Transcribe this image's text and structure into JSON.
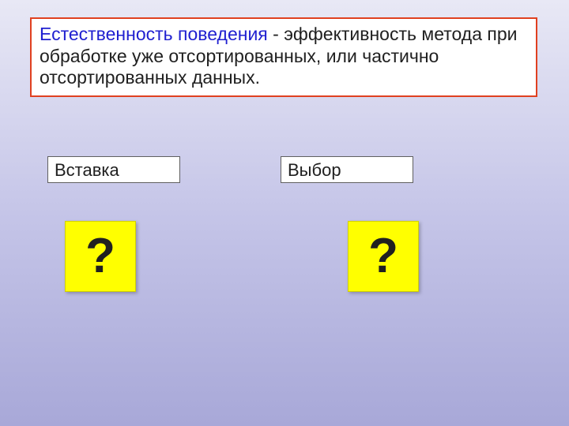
{
  "definition": {
    "term": "Естественность поведения",
    "desc": " - эффективность метода при обработке уже отсортированных, или частично отсортированных данных."
  },
  "labels": {
    "left": "Вставка",
    "right": "Выбор"
  },
  "questions": {
    "left": "?",
    "right": "?"
  }
}
